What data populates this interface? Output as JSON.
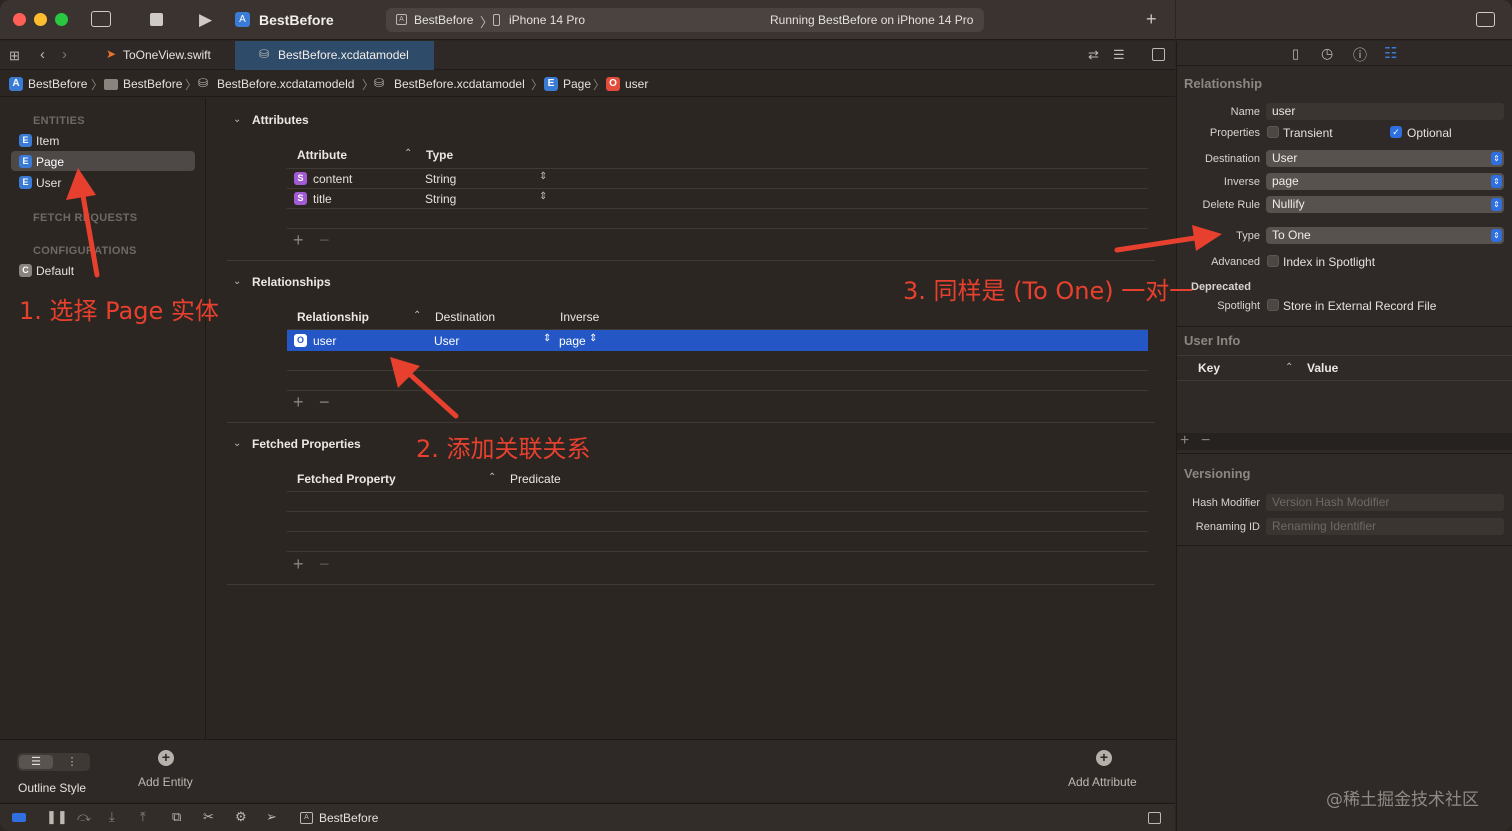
{
  "toolbar": {
    "app_name": "BestBefore",
    "scheme": "BestBefore",
    "device": "iPhone 14 Pro",
    "status": "Running BestBefore on iPhone 14 Pro"
  },
  "tabs": [
    {
      "label": "ToOneView.swift"
    },
    {
      "label": "BestBefore.xcdatamodel"
    }
  ],
  "breadcrumb": [
    "BestBefore",
    "BestBefore",
    "BestBefore.xcdatamodeld",
    "BestBefore.xcdatamodel",
    "Page",
    "user"
  ],
  "sidebar": {
    "entities_header": "ENTITIES",
    "entities": [
      {
        "badge": "E",
        "label": "Item"
      },
      {
        "badge": "E",
        "label": "Page"
      },
      {
        "badge": "E",
        "label": "User"
      }
    ],
    "fetch_requests_header": "FETCH REQUESTS",
    "configurations_header": "CONFIGURATIONS",
    "configurations": [
      {
        "badge": "C",
        "label": "Default"
      }
    ]
  },
  "editor": {
    "attributes": {
      "title": "Attributes",
      "col_attribute": "Attribute",
      "col_type": "Type",
      "rows": [
        {
          "badge": "S",
          "name": "content",
          "type": "String"
        },
        {
          "badge": "S",
          "name": "title",
          "type": "String"
        }
      ]
    },
    "relationships": {
      "title": "Relationships",
      "col_relationship": "Relationship",
      "col_destination": "Destination",
      "col_inverse": "Inverse",
      "rows": [
        {
          "badge": "O",
          "name": "user",
          "destination": "User",
          "inverse": "page"
        }
      ]
    },
    "fetched": {
      "title": "Fetched Properties",
      "col_property": "Fetched Property",
      "col_predicate": "Predicate"
    }
  },
  "bottom": {
    "outline_style": "Outline Style",
    "add_entity": "Add Entity",
    "add_attribute": "Add Attribute"
  },
  "statusbar": {
    "scheme": "BestBefore"
  },
  "inspector": {
    "relationship_header": "Relationship",
    "name_label": "Name",
    "name_value": "user",
    "properties_label": "Properties",
    "transient_label": "Transient",
    "optional_label": "Optional",
    "destination_label": "Destination",
    "destination_value": "User",
    "inverse_label": "Inverse",
    "inverse_value": "page",
    "delete_rule_label": "Delete Rule",
    "delete_rule_value": "Nullify",
    "type_label": "Type",
    "type_value": "To One",
    "advanced_label": "Advanced",
    "index_spotlight_label": "Index in Spotlight",
    "deprecated_label": "Deprecated",
    "spotlight_label": "Spotlight",
    "store_external_label": "Store in External Record File",
    "user_info_header": "User Info",
    "col_key": "Key",
    "col_value": "Value",
    "versioning_header": "Versioning",
    "hash_modifier_label": "Hash Modifier",
    "hash_modifier_placeholder": "Version Hash Modifier",
    "renaming_id_label": "Renaming ID",
    "renaming_id_placeholder": "Renaming Identifier"
  },
  "annotations": {
    "step1": "1. 选择 Page 实体",
    "step2": "2. 添加关联关系",
    "step3": "3. 同样是 (To One) 一对一"
  },
  "watermark": "@稀土掘金技术社区",
  "colors": {
    "accent": "#2457c5",
    "annotation": "#e8402e",
    "background": "#2b2622"
  }
}
